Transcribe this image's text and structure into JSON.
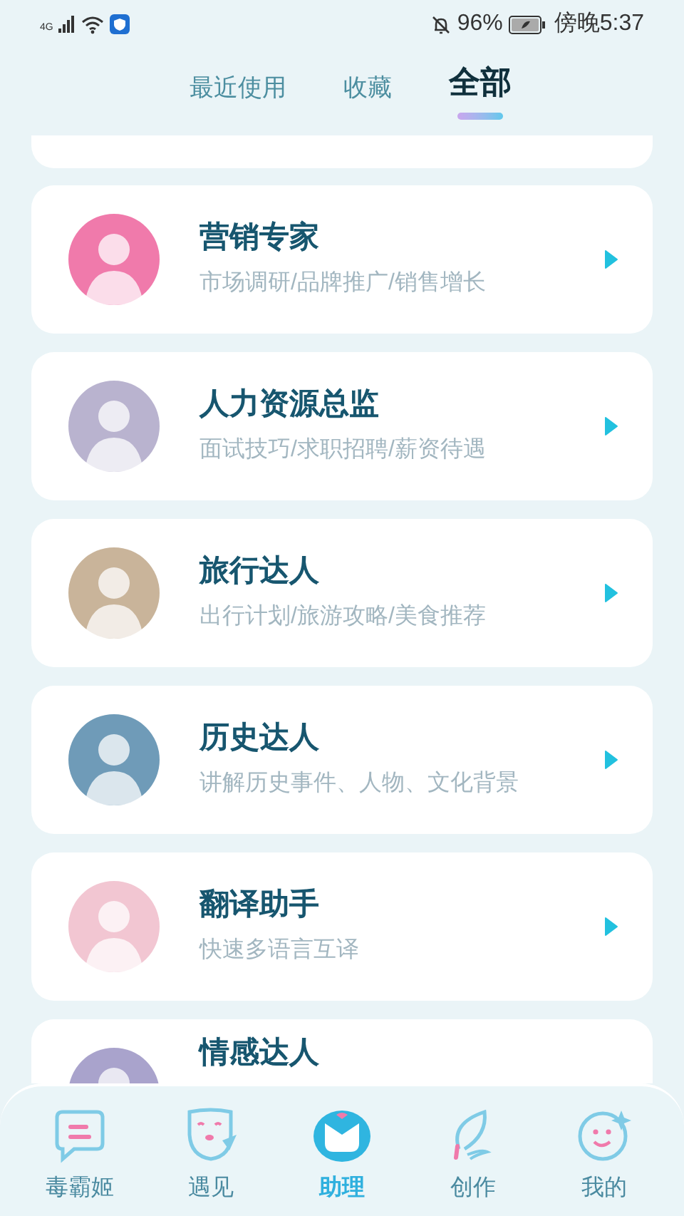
{
  "status_bar": {
    "network": "4G",
    "battery": "96%",
    "time": "傍晚5:37"
  },
  "tabs": [
    {
      "label": "最近使用",
      "selected": false
    },
    {
      "label": "收藏",
      "selected": false
    },
    {
      "label": "全部",
      "selected": true
    }
  ],
  "assistants": [
    {
      "name": "营销专家",
      "description": "市场调研/品牌推广/销售增长",
      "color": "#f07aab"
    },
    {
      "name": "人力资源总监",
      "description": "面试技巧/求职招聘/薪资待遇",
      "color": "#b9b3cf"
    },
    {
      "name": "旅行达人",
      "description": "出行计划/旅游攻略/美食推荐",
      "color": "#c9b49a"
    },
    {
      "name": "历史达人",
      "description": "讲解历史事件、人物、文化背景",
      "color": "#6f9bb8"
    },
    {
      "name": "翻译助手",
      "description": "快速多语言互译",
      "color": "#f2c6d2"
    },
    {
      "name": "情感达人",
      "color": "#a9a3cc"
    }
  ],
  "nav": [
    {
      "label": "毒霸姬",
      "kind": "chat",
      "selected": false
    },
    {
      "label": "遇见",
      "kind": "mask",
      "selected": false
    },
    {
      "label": "助理",
      "kind": "assistant",
      "selected": true
    },
    {
      "label": "创作",
      "kind": "feather",
      "selected": false
    },
    {
      "label": "我的",
      "kind": "smile",
      "selected": false
    }
  ]
}
